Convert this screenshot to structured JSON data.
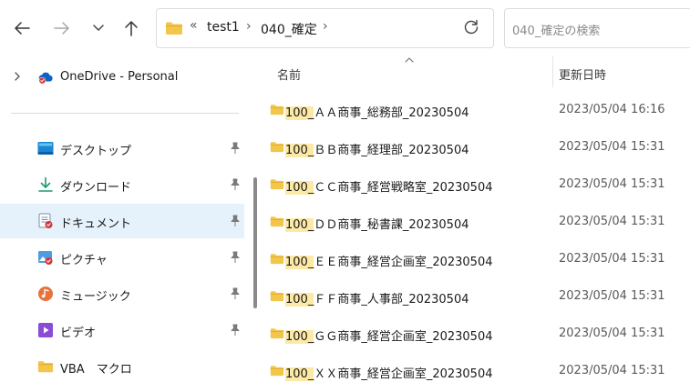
{
  "toolbar": {
    "address": {
      "overflow_glyph": "«",
      "crumbs": [
        "test1",
        "040_確定"
      ],
      "separator": "›"
    },
    "search": {
      "placeholder": "040_確定の検索"
    }
  },
  "nav": {
    "items": [
      {
        "label": "OneDrive - Personal",
        "icon": "onedrive-icon"
      },
      {
        "label": "デスクトップ",
        "icon": "desktop-icon",
        "pinned": true
      },
      {
        "label": "ダウンロード",
        "icon": "download-icon",
        "pinned": true
      },
      {
        "label": "ドキュメント",
        "icon": "documents-icon",
        "pinned": true,
        "selected": true
      },
      {
        "label": "ピクチャ",
        "icon": "pictures-icon",
        "pinned": true
      },
      {
        "label": "ミュージック",
        "icon": "music-icon",
        "pinned": true
      },
      {
        "label": "ビデオ",
        "icon": "video-icon",
        "pinned": true
      },
      {
        "label": "VBA　マクロ",
        "icon": "folder-icon"
      }
    ]
  },
  "list": {
    "columns": {
      "name": "名前",
      "modified": "更新日時"
    },
    "highlight_prefix": "100_",
    "rows": [
      {
        "prefix": "100_",
        "rest": "ＡＡ商事_総務部_20230504",
        "modified": "2023/05/04 16:16"
      },
      {
        "prefix": "100_",
        "rest": "ＢＢ商事_経理部_20230504",
        "modified": "2023/05/04 15:31"
      },
      {
        "prefix": "100_",
        "rest": "ＣＣ商事_経営戦略室_20230504",
        "modified": "2023/05/04 15:31"
      },
      {
        "prefix": "100_",
        "rest": "ＤＤ商事_秘書課_20230504",
        "modified": "2023/05/04 15:31"
      },
      {
        "prefix": "100_",
        "rest": "ＥＥ商事_経営企画室_20230504",
        "modified": "2023/05/04 15:31"
      },
      {
        "prefix": "100_",
        "rest": "ＦＦ商事_人事部_20230504",
        "modified": "2023/05/04 15:31"
      },
      {
        "prefix": "100_",
        "rest": "ＧＧ商事_経営企画室_20230504",
        "modified": "2023/05/04 15:31"
      },
      {
        "prefix": "100_",
        "rest": "ＸＸ商事_経営企画室_20230504",
        "modified": "2023/05/04 15:31"
      }
    ]
  },
  "colors": {
    "folder": "#f2c54b",
    "selection": "#e5f1fb",
    "highlight": "#fde9a6"
  }
}
